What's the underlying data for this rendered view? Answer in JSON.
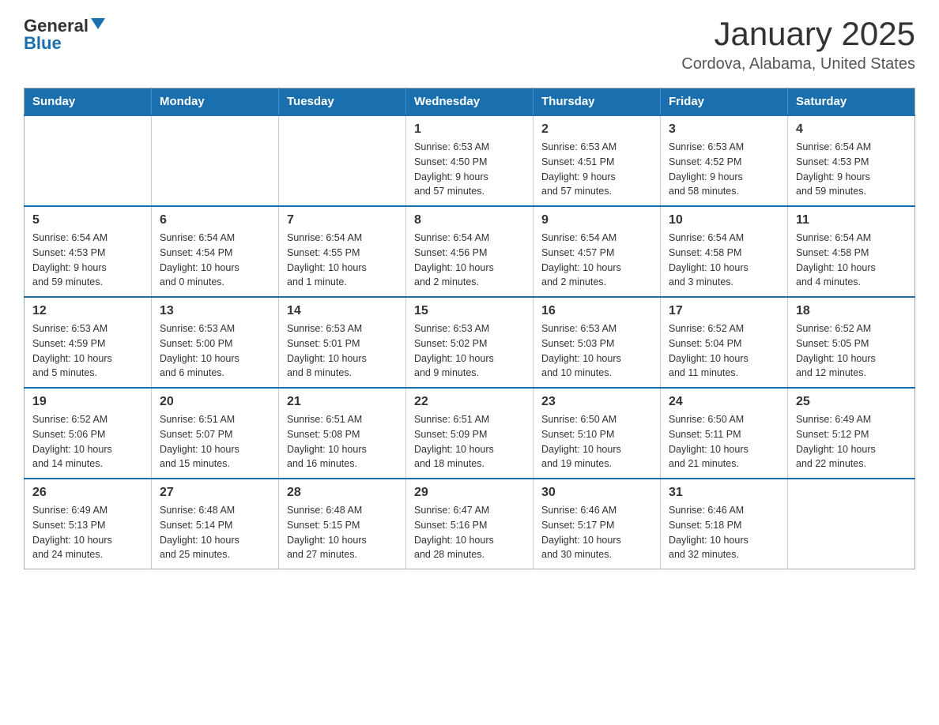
{
  "logo": {
    "general": "General",
    "blue": "Blue",
    "arrow": "▼"
  },
  "title": "January 2025",
  "subtitle": "Cordova, Alabama, United States",
  "weekdays": [
    "Sunday",
    "Monday",
    "Tuesday",
    "Wednesday",
    "Thursday",
    "Friday",
    "Saturday"
  ],
  "weeks": [
    [
      {
        "day": "",
        "info": ""
      },
      {
        "day": "",
        "info": ""
      },
      {
        "day": "",
        "info": ""
      },
      {
        "day": "1",
        "info": "Sunrise: 6:53 AM\nSunset: 4:50 PM\nDaylight: 9 hours\nand 57 minutes."
      },
      {
        "day": "2",
        "info": "Sunrise: 6:53 AM\nSunset: 4:51 PM\nDaylight: 9 hours\nand 57 minutes."
      },
      {
        "day": "3",
        "info": "Sunrise: 6:53 AM\nSunset: 4:52 PM\nDaylight: 9 hours\nand 58 minutes."
      },
      {
        "day": "4",
        "info": "Sunrise: 6:54 AM\nSunset: 4:53 PM\nDaylight: 9 hours\nand 59 minutes."
      }
    ],
    [
      {
        "day": "5",
        "info": "Sunrise: 6:54 AM\nSunset: 4:53 PM\nDaylight: 9 hours\nand 59 minutes."
      },
      {
        "day": "6",
        "info": "Sunrise: 6:54 AM\nSunset: 4:54 PM\nDaylight: 10 hours\nand 0 minutes."
      },
      {
        "day": "7",
        "info": "Sunrise: 6:54 AM\nSunset: 4:55 PM\nDaylight: 10 hours\nand 1 minute."
      },
      {
        "day": "8",
        "info": "Sunrise: 6:54 AM\nSunset: 4:56 PM\nDaylight: 10 hours\nand 2 minutes."
      },
      {
        "day": "9",
        "info": "Sunrise: 6:54 AM\nSunset: 4:57 PM\nDaylight: 10 hours\nand 2 minutes."
      },
      {
        "day": "10",
        "info": "Sunrise: 6:54 AM\nSunset: 4:58 PM\nDaylight: 10 hours\nand 3 minutes."
      },
      {
        "day": "11",
        "info": "Sunrise: 6:54 AM\nSunset: 4:58 PM\nDaylight: 10 hours\nand 4 minutes."
      }
    ],
    [
      {
        "day": "12",
        "info": "Sunrise: 6:53 AM\nSunset: 4:59 PM\nDaylight: 10 hours\nand 5 minutes."
      },
      {
        "day": "13",
        "info": "Sunrise: 6:53 AM\nSunset: 5:00 PM\nDaylight: 10 hours\nand 6 minutes."
      },
      {
        "day": "14",
        "info": "Sunrise: 6:53 AM\nSunset: 5:01 PM\nDaylight: 10 hours\nand 8 minutes."
      },
      {
        "day": "15",
        "info": "Sunrise: 6:53 AM\nSunset: 5:02 PM\nDaylight: 10 hours\nand 9 minutes."
      },
      {
        "day": "16",
        "info": "Sunrise: 6:53 AM\nSunset: 5:03 PM\nDaylight: 10 hours\nand 10 minutes."
      },
      {
        "day": "17",
        "info": "Sunrise: 6:52 AM\nSunset: 5:04 PM\nDaylight: 10 hours\nand 11 minutes."
      },
      {
        "day": "18",
        "info": "Sunrise: 6:52 AM\nSunset: 5:05 PM\nDaylight: 10 hours\nand 12 minutes."
      }
    ],
    [
      {
        "day": "19",
        "info": "Sunrise: 6:52 AM\nSunset: 5:06 PM\nDaylight: 10 hours\nand 14 minutes."
      },
      {
        "day": "20",
        "info": "Sunrise: 6:51 AM\nSunset: 5:07 PM\nDaylight: 10 hours\nand 15 minutes."
      },
      {
        "day": "21",
        "info": "Sunrise: 6:51 AM\nSunset: 5:08 PM\nDaylight: 10 hours\nand 16 minutes."
      },
      {
        "day": "22",
        "info": "Sunrise: 6:51 AM\nSunset: 5:09 PM\nDaylight: 10 hours\nand 18 minutes."
      },
      {
        "day": "23",
        "info": "Sunrise: 6:50 AM\nSunset: 5:10 PM\nDaylight: 10 hours\nand 19 minutes."
      },
      {
        "day": "24",
        "info": "Sunrise: 6:50 AM\nSunset: 5:11 PM\nDaylight: 10 hours\nand 21 minutes."
      },
      {
        "day": "25",
        "info": "Sunrise: 6:49 AM\nSunset: 5:12 PM\nDaylight: 10 hours\nand 22 minutes."
      }
    ],
    [
      {
        "day": "26",
        "info": "Sunrise: 6:49 AM\nSunset: 5:13 PM\nDaylight: 10 hours\nand 24 minutes."
      },
      {
        "day": "27",
        "info": "Sunrise: 6:48 AM\nSunset: 5:14 PM\nDaylight: 10 hours\nand 25 minutes."
      },
      {
        "day": "28",
        "info": "Sunrise: 6:48 AM\nSunset: 5:15 PM\nDaylight: 10 hours\nand 27 minutes."
      },
      {
        "day": "29",
        "info": "Sunrise: 6:47 AM\nSunset: 5:16 PM\nDaylight: 10 hours\nand 28 minutes."
      },
      {
        "day": "30",
        "info": "Sunrise: 6:46 AM\nSunset: 5:17 PM\nDaylight: 10 hours\nand 30 minutes."
      },
      {
        "day": "31",
        "info": "Sunrise: 6:46 AM\nSunset: 5:18 PM\nDaylight: 10 hours\nand 32 minutes."
      },
      {
        "day": "",
        "info": ""
      }
    ]
  ]
}
